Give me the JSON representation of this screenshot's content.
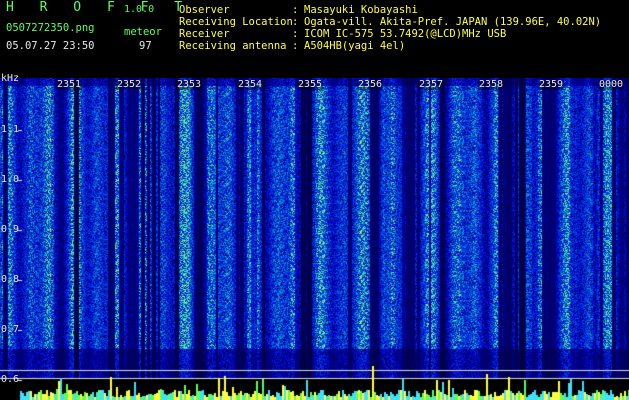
{
  "app": {
    "name": "H R O F F T",
    "version": "1.0.0"
  },
  "file": {
    "name": "0507272350.png",
    "datetime": "05.07.27 23:50"
  },
  "detection": {
    "label": "meteor",
    "count": "97"
  },
  "info": {
    "observer_key": "Observer",
    "observer_val": "Masayuki Kobayashi",
    "location_key": "Receiving Location",
    "location_val": "Ogata-vill. Akita-Pref. JAPAN (139.96E, 40.02N)",
    "receiver_key": "Receiver",
    "receiver_val": "ICOM IC-575 53.7492(@LCD)MHz USB",
    "antenna_key": "Receiving antenna",
    "antenna_val": "A504HB(yagi 4el)",
    "colon": ":"
  },
  "axis": {
    "y_unit": "kHz",
    "y_ticks": [
      "1.1",
      "1.0",
      "0.9",
      "0.8",
      "0.7",
      "0.6"
    ],
    "x_ticks": [
      "2351",
      "2352",
      "2353",
      "2354",
      "2355",
      "2356",
      "2357",
      "2358",
      "2359",
      "0000"
    ]
  },
  "colors": {
    "background": "#000000",
    "title_green": "#5cff5c",
    "info_yellow": "#ffff40",
    "spectrum_base": "#0a1a8c",
    "spectrum_hot": "#40ff60"
  }
}
